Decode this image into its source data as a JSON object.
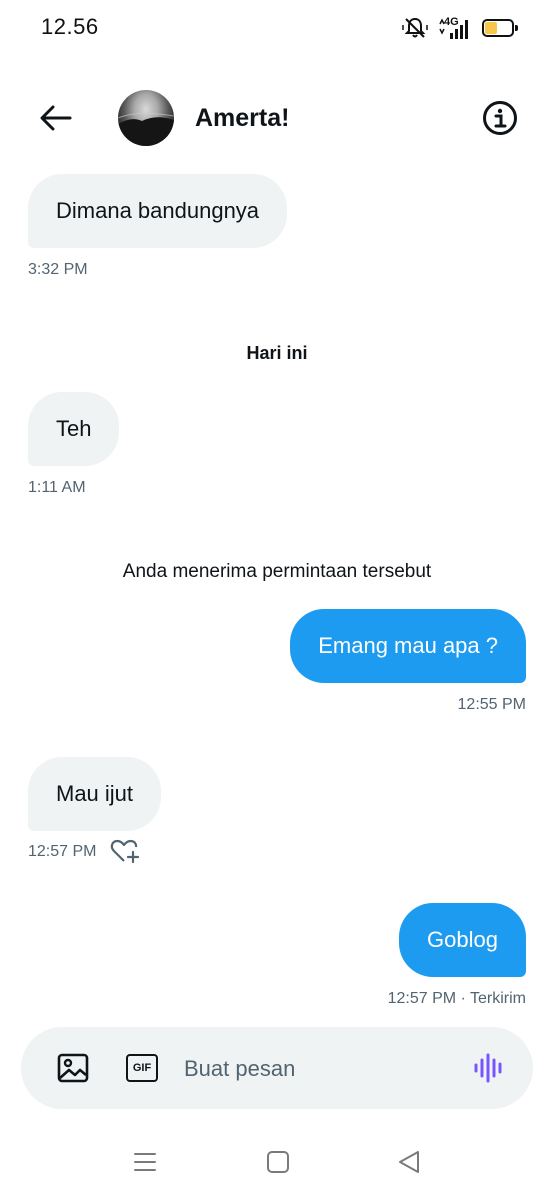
{
  "status_bar": {
    "time": "12.56",
    "network": "4G",
    "battery_level": 0.45
  },
  "header": {
    "contact_name": "Amerta!"
  },
  "messages": [
    {
      "text": "Dimana bandungnya",
      "time": "3:32 PM"
    },
    {
      "text": "Teh",
      "time": "1:11 AM"
    },
    {
      "text": "Emang mau apa ?",
      "time": "12:55 PM"
    },
    {
      "text": "Mau ijut",
      "time": "12:57 PM"
    },
    {
      "text": "Goblog",
      "time": "12:57 PM · Terkirim"
    }
  ],
  "day_separator": "Hari ini",
  "system_message": "Anda menerima permintaan tersebut",
  "composer": {
    "placeholder": "Buat pesan",
    "gif_label": "GIF"
  },
  "colors": {
    "sent_bubble": "#1d9bf0",
    "received_bubble": "#eff3f4",
    "voice_icon": "#7856ff",
    "battery_fill": "#f5c84c"
  },
  "icons": [
    "arrow-left-icon",
    "info-icon",
    "heart-plus-icon",
    "image-icon",
    "gif-icon",
    "voice-waveform-icon",
    "mute-bell-icon",
    "signal-icon",
    "battery-icon"
  ]
}
